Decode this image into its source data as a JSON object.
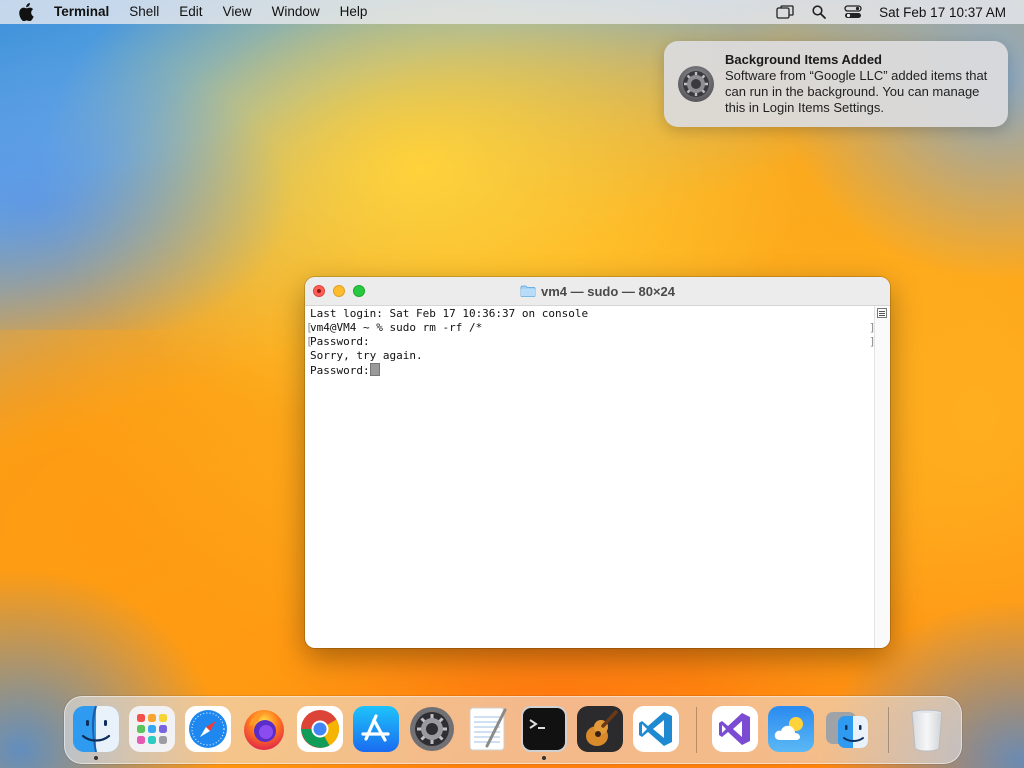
{
  "menubar": {
    "app_name": "Terminal",
    "menus": [
      "Shell",
      "Edit",
      "View",
      "Window",
      "Help"
    ],
    "clock": "Sat Feb 17  10:37 AM",
    "icons": [
      "apple-icon",
      "screen-mirroring-icon",
      "search-icon",
      "control-center-icon"
    ]
  },
  "notification": {
    "title": "Background Items Added",
    "body": "Software from “Google LLC” added items that can run in the background. You can manage this in Login Items Settings.",
    "icon": "system-settings-gear-icon"
  },
  "terminal": {
    "title": "vm4 — sudo — 80×24",
    "lines": [
      "Last login: Sat Feb 17 10:36:37 on console",
      "vm4@VM4 ~ % sudo rm -rf /*",
      "Password:",
      "Sorry, try again.",
      "Password:"
    ]
  },
  "dock": {
    "apps": [
      "Finder",
      "Launchpad",
      "Safari",
      "Firefox",
      "Google Chrome",
      "App Store",
      "System Settings",
      "TextEdit",
      "Terminal",
      "GarageBand",
      "Visual Studio Code",
      "Visual Studio",
      "Weather",
      "Migration Assistant",
      "Trash"
    ]
  },
  "colors": {
    "close": "#ff5f57",
    "minimize": "#febc2e",
    "maximize": "#28c840"
  }
}
